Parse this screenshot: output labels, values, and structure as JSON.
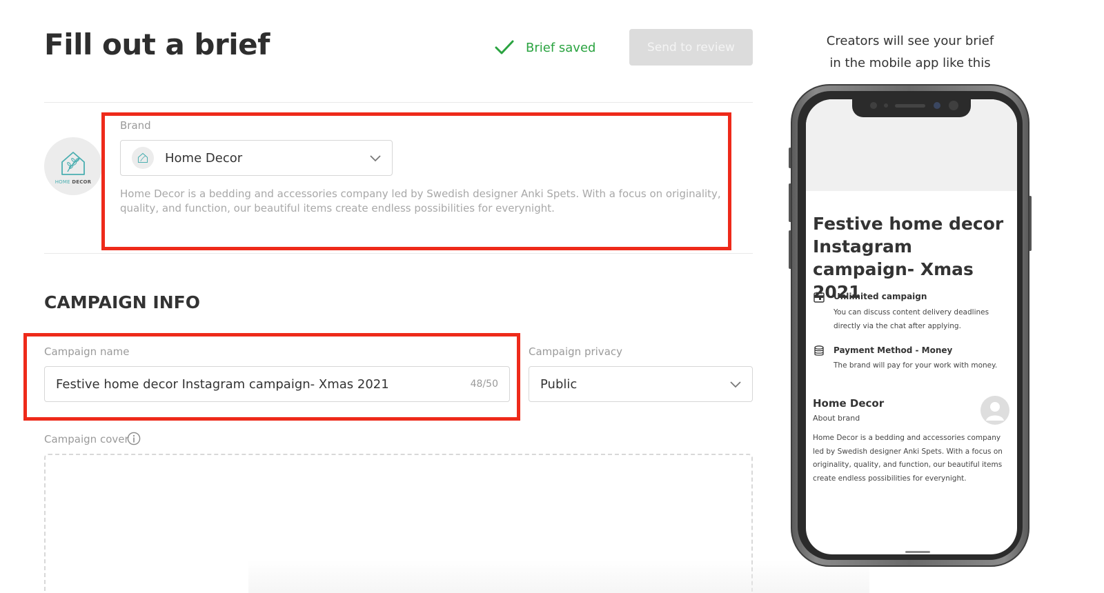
{
  "header": {
    "title": "Fill out a brief",
    "saved_status": "Brief saved",
    "send_button": "Send to review"
  },
  "colors": {
    "saved_green": "#2aa340",
    "highlight_red": "#ee2a1a",
    "button_disabled": "#dcdcdc"
  },
  "brand": {
    "label": "Brand",
    "selected": "Home Decor",
    "description": "Home Decor is a bedding and accessories company led by Swedish designer Anki Spets. With a focus on originality, quality, and function, our beautiful items create endless possibilities for everynight.",
    "logo_text_1": "HOME",
    "logo_text_2": "DECOR"
  },
  "campaign": {
    "section_title": "CAMPAIGN INFO",
    "name_label": "Campaign name",
    "name_value": "Festive home decor Instagram campaign- Xmas 2021",
    "name_counter": "48/50",
    "privacy_label": "Campaign privacy",
    "privacy_value": "Public",
    "cover_label": "Campaign cover"
  },
  "preview": {
    "caption_line1": "Creators will see your brief",
    "caption_line2": "in the mobile app like this",
    "title": "Festive home decor Instagram campaign- Xmas 2021",
    "unlimited_head": "Unlimited campaign",
    "unlimited_text": "You can discuss content delivery deadlines directly via the chat after applying.",
    "payment_head": "Payment Method - Money",
    "payment_text": "The brand will pay for your work with money.",
    "brand_name": "Home Decor",
    "about_brand": "About brand",
    "brand_desc": "Home Decor is a bedding and accessories company led by Swedish designer Anki Spets. With a focus on originality, quality, and function, our beautiful items create endless possibilities for everynight."
  }
}
